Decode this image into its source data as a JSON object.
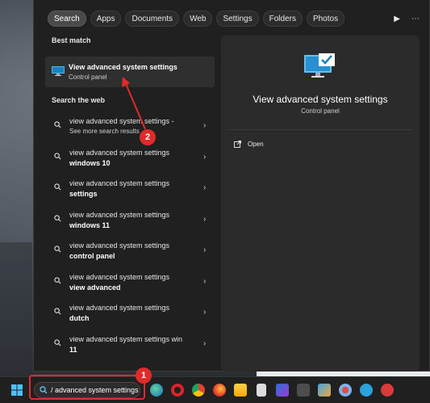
{
  "filters": [
    "Search",
    "Apps",
    "Documents",
    "Web",
    "Settings",
    "Folders",
    "Photos"
  ],
  "best_match": {
    "section_label": "Best match",
    "title": "View advanced system settings",
    "subtitle": "Control panel"
  },
  "web": {
    "section_label": "Search the web",
    "items": [
      {
        "line1": "view advanced system settings -",
        "line2": "See more search results"
      },
      {
        "line1": "view advanced system settings",
        "line2": "windows 10"
      },
      {
        "line1": "view advanced system settings",
        "line2": "settings"
      },
      {
        "line1": "view advanced system settings",
        "line2": "windows 11"
      },
      {
        "line1": "view advanced system settings",
        "line2": "control panel"
      },
      {
        "line1": "view advanced system settings",
        "line2": "view advanced"
      },
      {
        "line1": "view advanced system settings",
        "line2": "dutch"
      },
      {
        "line1": "view advanced system settings win",
        "line2": "11"
      }
    ]
  },
  "detail": {
    "title": "View advanced system settings",
    "subtitle": "Control panel",
    "open_label": "Open"
  },
  "taskbar": {
    "search_text": "/ advanced system settings",
    "icons": [
      "edge-icon",
      "opera-icon",
      "chrome-icon",
      "firefox-icon",
      "file-explorer-icon",
      "app-icon",
      "store-icon",
      "calculator-icon",
      "photos-icon",
      "maps-icon",
      "telegram-icon",
      "network-icon"
    ]
  },
  "annotations": {
    "badge1": "1",
    "badge2": "2"
  },
  "colors": {
    "accent": "#e02b2b",
    "panel": "#202020",
    "pane": "#2b2b2b"
  }
}
